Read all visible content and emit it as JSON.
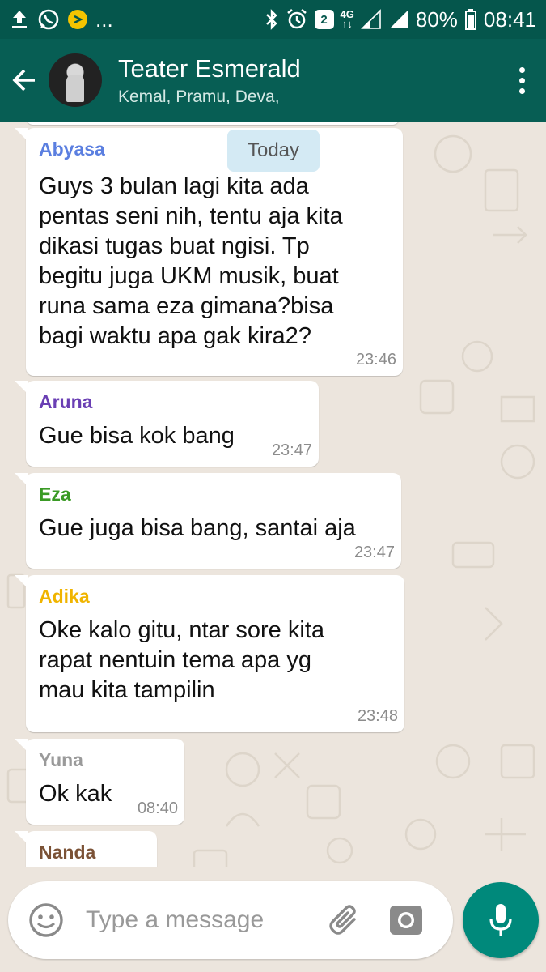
{
  "status_bar": {
    "dots": "...",
    "sim_badge": "2",
    "network_top": "4G",
    "network_bottom": "↑↓",
    "battery": "80%",
    "time": "08:41"
  },
  "header": {
    "title": "Teater Esmerald",
    "members": "Kemal, Pramu, Deva,"
  },
  "date_chip": "Today",
  "messages": [
    {
      "sender": "Abyasa",
      "sender_color": "#5b7fe0",
      "text": "Guys 3 bulan lagi kita ada\npentas seni nih, tentu aja kita\ndikasi tugas buat ngisi. Tp\nbegitu juga UKM musik, buat\nruna sama eza gimana?bisa\nbagi waktu apa gak kira2?",
      "time": "23:46"
    },
    {
      "sender": "Aruna",
      "sender_color": "#6a3fb4",
      "text": "Gue bisa kok bang",
      "time": "23:47"
    },
    {
      "sender": "Eza",
      "sender_color": "#3a9a25",
      "text": "Gue juga bisa bang, santai aja",
      "time": "23:47"
    },
    {
      "sender": "Adika",
      "sender_color": "#f0b400",
      "text": "Oke kalo gitu, ntar sore kita\nrapat nentuin tema apa yg\nmau kita tampilin",
      "time": "23:48"
    },
    {
      "sender": "Yuna",
      "sender_color": "#9a9a9a",
      "text": "Ok kak",
      "time": "08:40"
    },
    {
      "sender": "Nanda",
      "sender_color": "#7b5236",
      "text": "",
      "time": ""
    }
  ],
  "composer": {
    "placeholder": "Type a message"
  },
  "colors": {
    "toolbar": "#075e54",
    "status_bar": "#05564c",
    "chat_background": "#ece5dd",
    "mic_button": "#00897b",
    "date_chip": "#d4eaf4"
  },
  "icons": {
    "status_left": [
      "upload-icon",
      "whatsapp-icon",
      "play-badge-icon"
    ],
    "status_right": [
      "bluetooth-icon",
      "alarm-icon",
      "sim2-icon",
      "signal-icon",
      "battery-icon"
    ],
    "toolbar": [
      "back-arrow-icon",
      "more-vert-icon"
    ],
    "composer": [
      "emoji-icon",
      "attachment-icon",
      "camera-icon",
      "microphone-icon"
    ]
  }
}
